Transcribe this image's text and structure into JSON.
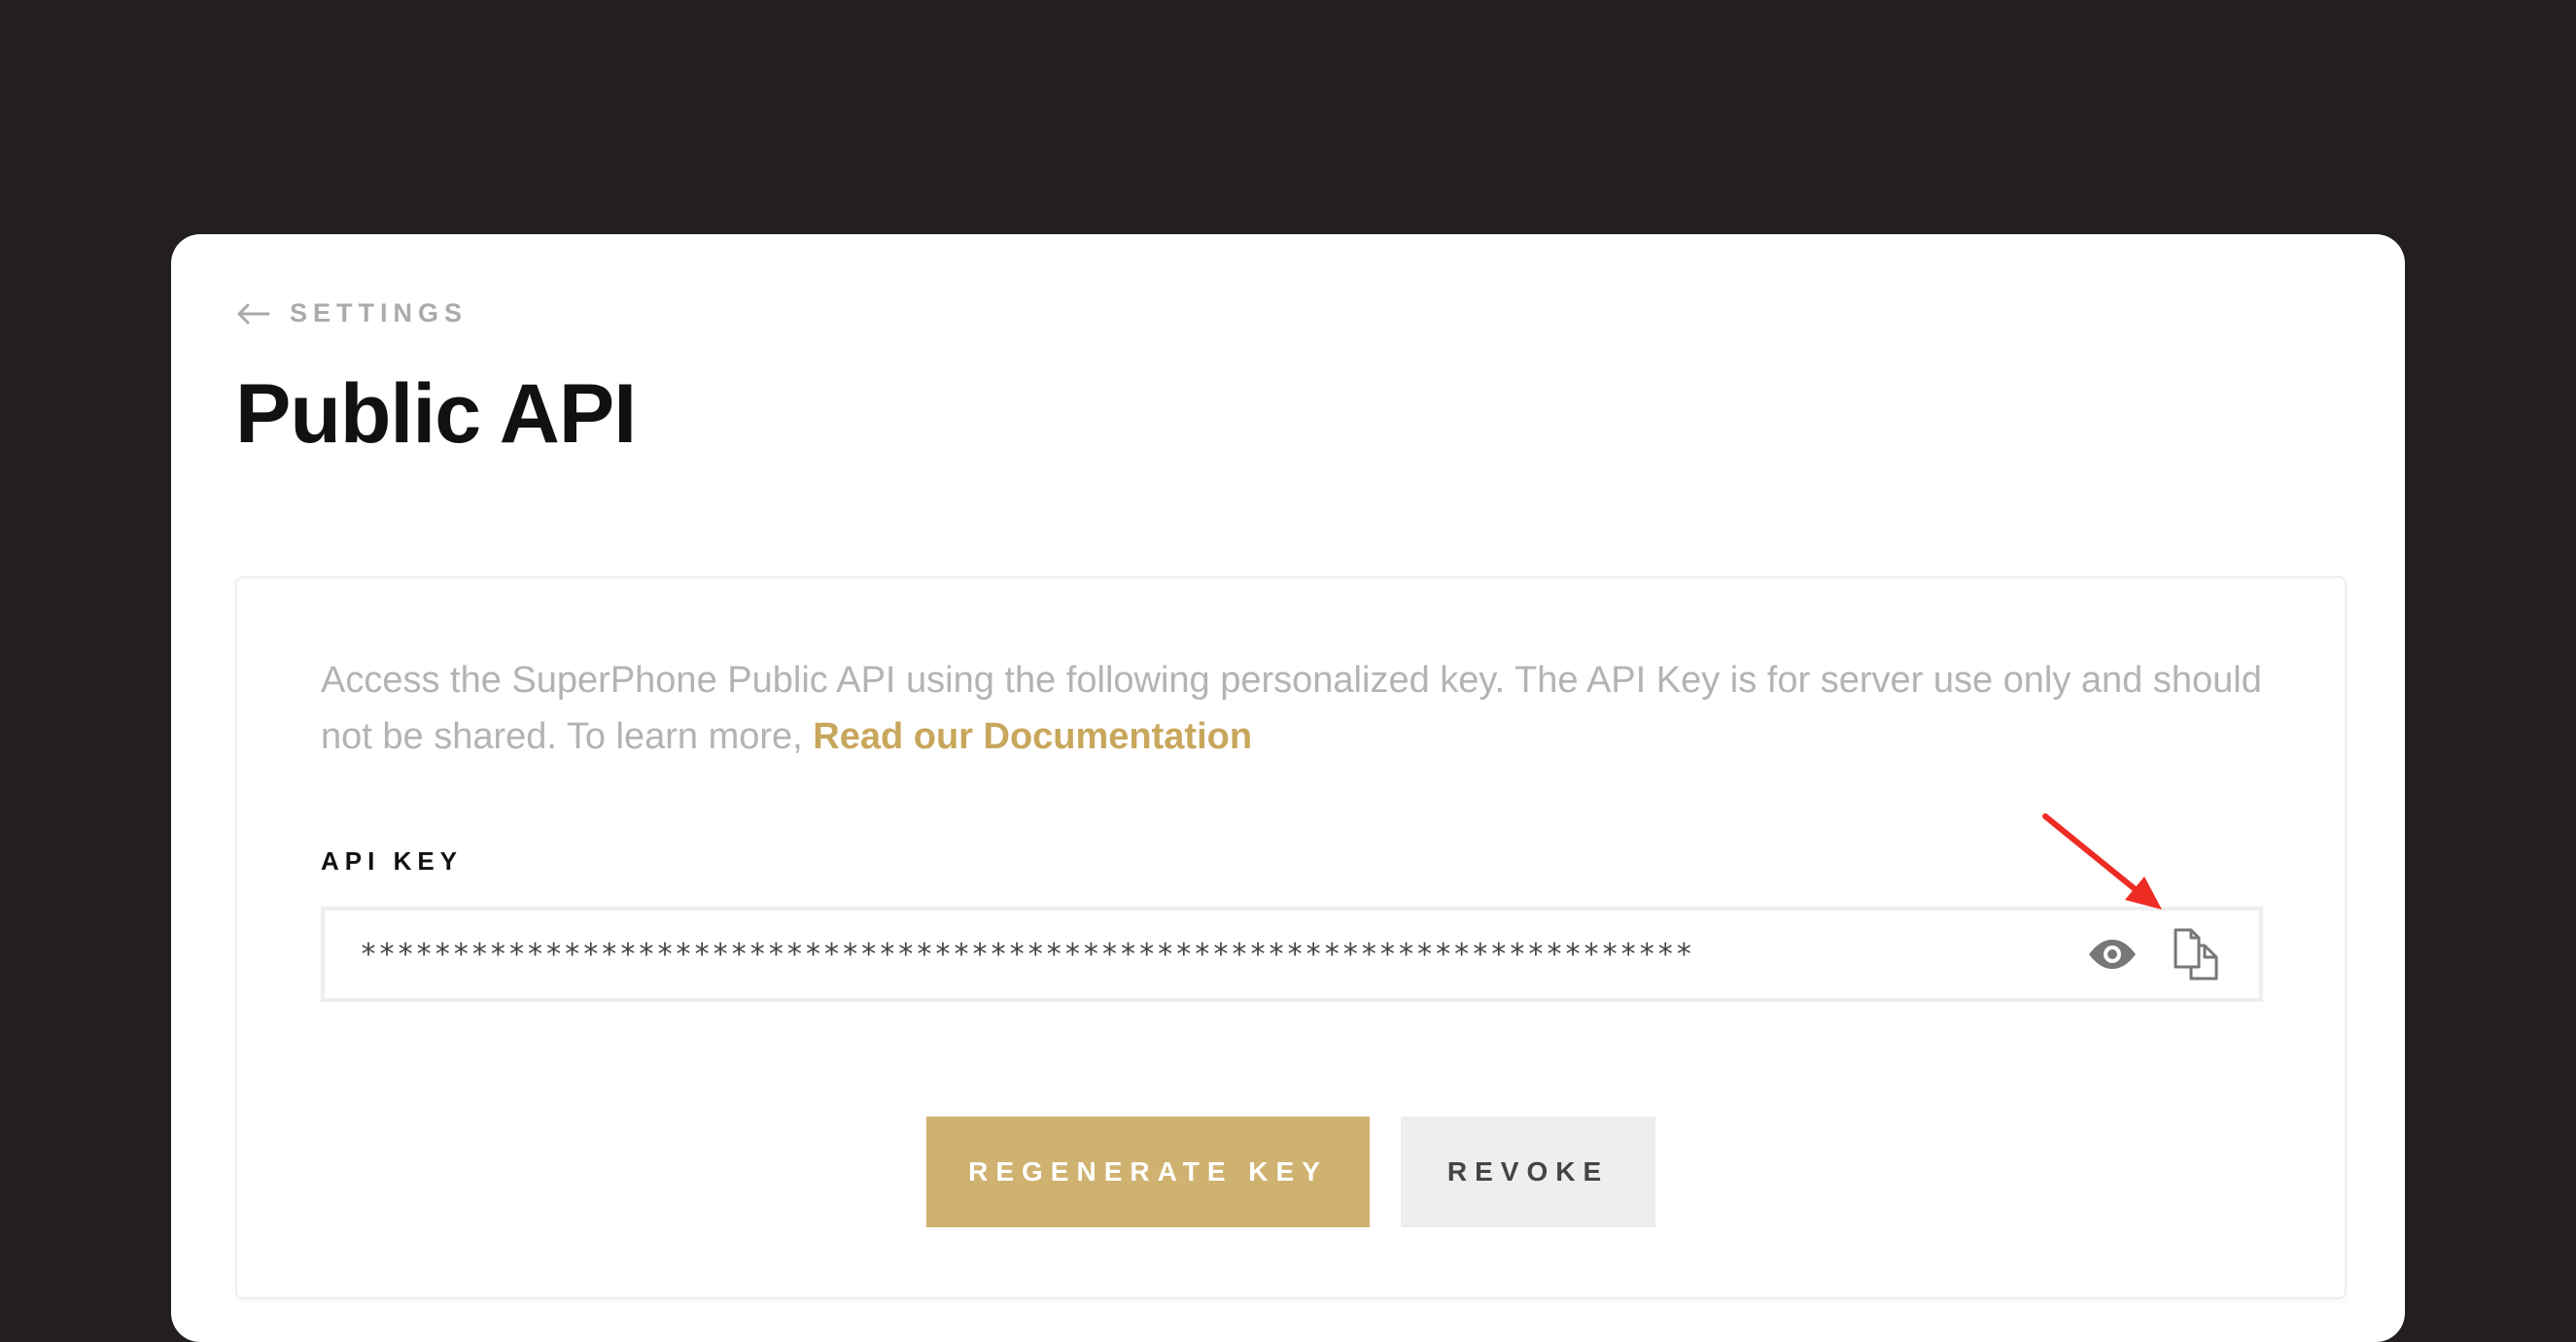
{
  "breadcrumb": {
    "back_label": "SETTINGS",
    "icon": "arrow-left-icon"
  },
  "page": {
    "title": "Public API"
  },
  "api_panel": {
    "description": "Access the SuperPhone Public API using the following personalized key. The API Key is for server use only and should not be shared. To learn more, ",
    "doc_link_label": "Read our Documentation",
    "field_label": "API KEY",
    "key_value": "************************************************************************",
    "icons": [
      "eye-icon",
      "copy-icon"
    ]
  },
  "actions": {
    "regenerate_label": "REGENERATE KEY",
    "revoke_label": "REVOKE"
  },
  "colors": {
    "background": "#231f20",
    "accent": "#cfb270",
    "link": "#c8a75c",
    "annotation": "#ee2c24"
  }
}
